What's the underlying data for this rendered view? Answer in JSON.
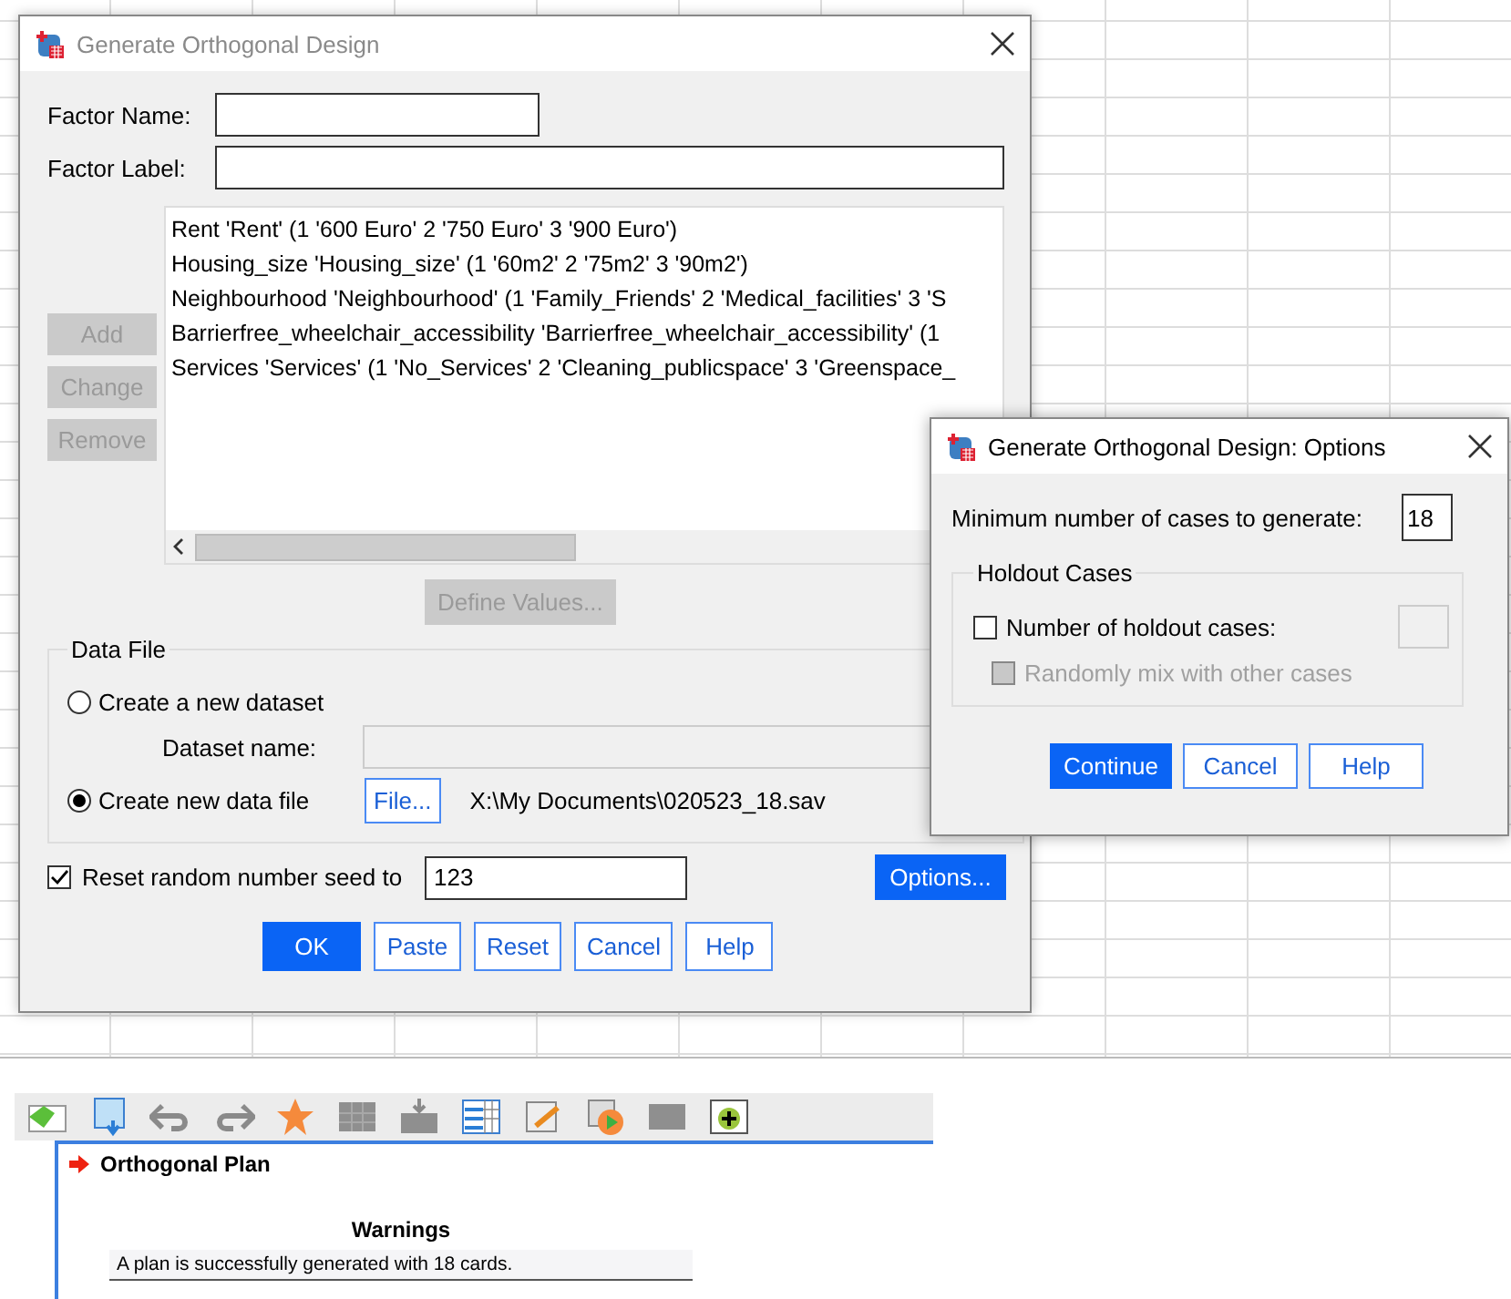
{
  "main_dialog": {
    "title": "Generate Orthogonal Design",
    "active": false,
    "factor_name": {
      "label": "Factor Name:"
    },
    "factor_label": {
      "label": "Factor Label:"
    },
    "side_buttons": [
      {
        "label": "Add",
        "disabled": true
      },
      {
        "label": "Change",
        "disabled": true
      },
      {
        "label": "Remove",
        "disabled": true
      }
    ],
    "factors": [
      "Rent 'Rent' (1 '600 Euro' 2 '750 Euro' 3 '900 Euro')",
      "Housing_size 'Housing_size' (1 '60m2' 2 '75m2' 3 '90m2')",
      "Neighbourhood 'Neighbourhood' (1 'Family_Friends' 2 'Medical_facilities' 3 'S",
      "Barrierfree_wheelchair_accessibility 'Barrierfree_wheelchair_accessibility' (1",
      "Services 'Services' (1 'No_Services' 2 'Cleaning_publicspace' 3 'Greenspace_"
    ],
    "define_values": {
      "label": "Define Values...",
      "disabled": true
    },
    "data_file": {
      "title": "Data File",
      "options": [
        {
          "label": "Create a new dataset",
          "selected": false
        },
        {
          "label": "Create new data file",
          "selected": true
        }
      ],
      "dataset_name": {
        "label": "Dataset name:",
        "disabled": true
      },
      "file_button": {
        "label": "File..."
      },
      "file_path": "X:\\My Documents\\020523_18.sav"
    },
    "reset_seed": {
      "label": "Reset random number seed to",
      "checked": true,
      "value": "123"
    },
    "options_button": {
      "label": "Options...",
      "default": true
    },
    "buttons": [
      {
        "label": "OK",
        "default": true
      },
      {
        "label": "Paste",
        "default": false
      },
      {
        "label": "Reset",
        "default": false
      },
      {
        "label": "Cancel",
        "default": false
      },
      {
        "label": "Help",
        "default": false
      }
    ]
  },
  "options_dialog": {
    "title": "Generate Orthogonal Design: Options",
    "active": true,
    "min_cases": {
      "label": "Minimum number of cases to generate:",
      "value": "18"
    },
    "holdout": {
      "title": "Holdout Cases",
      "number": {
        "label": "Number of holdout cases:",
        "checked": false
      },
      "count_field": {
        "disabled": true
      },
      "random_mix": {
        "label": "Randomly mix with other cases",
        "checked": false,
        "disabled": true
      }
    },
    "buttons": [
      {
        "label": "Continue",
        "default": true
      },
      {
        "label": "Cancel",
        "default": false
      },
      {
        "label": "Help",
        "default": false
      }
    ]
  },
  "output": {
    "heading": "Orthogonal Plan",
    "table_title": "Warnings",
    "rows": [
      "A plan is successfully generated with 18 cards."
    ]
  }
}
